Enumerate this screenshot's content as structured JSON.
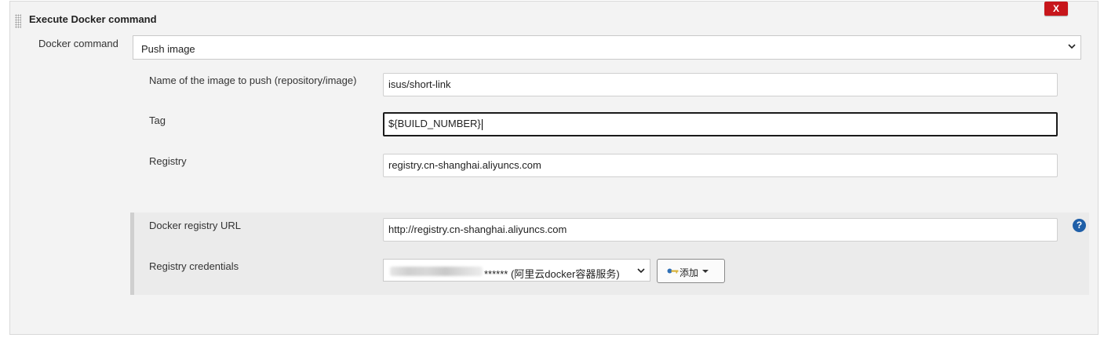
{
  "section": {
    "title": "Execute Docker command",
    "close_label": "X"
  },
  "docker_command": {
    "label": "Docker command",
    "selected": "Push image"
  },
  "fields": {
    "image_name": {
      "label": "Name of the image to push (repository/image)",
      "value": "isus/short-link"
    },
    "tag": {
      "label": "Tag",
      "value": "${BUILD_NUMBER}"
    },
    "registry": {
      "label": "Registry",
      "value": "registry.cn-shanghai.aliyuncs.com"
    }
  },
  "advanced": {
    "registry_url": {
      "label": "Docker registry URL",
      "value": "http://registry.cn-shanghai.aliyuncs.com"
    },
    "credentials": {
      "label": "Registry credentials",
      "selected_suffix": "****** (阿里云docker容器服务)"
    },
    "add_button": "添加",
    "help_icon": "?"
  },
  "icons": {
    "drag": "drag-handle-icon",
    "close": "close-icon",
    "help": "help-icon",
    "key": "key-icon",
    "chevron": "chevron-down-icon"
  },
  "colors": {
    "close_button": "#c7161b",
    "help_icon": "#1f5fa8",
    "panel_bg": "#f3f3f3",
    "advanced_bg": "#ebebeb"
  }
}
